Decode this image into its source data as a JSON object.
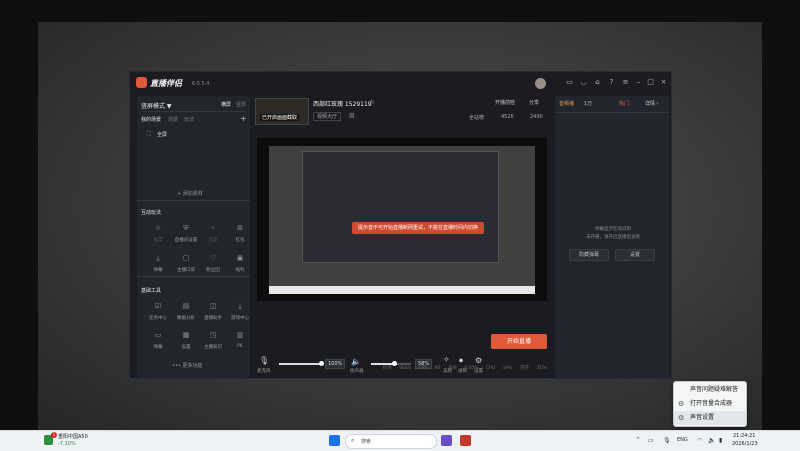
{
  "app": {
    "brand": "直播伴侣",
    "version": "6.5.5.4",
    "title_icons": [
      "chat-icon",
      "headset-icon",
      "shirt-icon",
      "help-icon",
      "menu-icon",
      "minimize-icon",
      "maximize-icon",
      "close-icon"
    ]
  },
  "left": {
    "mode_label": "竖屏模式 ▼",
    "orient_a": "横屏",
    "orient_b": "竖屏",
    "tabs": [
      "我的场景",
      "场景",
      "玩法"
    ],
    "add_icon": "+",
    "scene_item": "全屏",
    "add_material": "+ 添加素材",
    "interactive_title": "互动玩法",
    "interactive_items": [
      "投票",
      "直播间设置",
      "连麦",
      "红包",
      "弹幕",
      "主播口袋",
      "粉丝团",
      "福利"
    ],
    "tools_title": "基础工具",
    "tools_items": [
      "任务中心",
      "数据分析",
      "直播助手",
      "游戏中心",
      "弹幕",
      "设置",
      "主播知识",
      "PK"
    ],
    "more": "••• 更多功能"
  },
  "center": {
    "thumb_label": "已开启画面截取",
    "room_title": "西部红玫瑰 1529119",
    "tag": "视频大厅",
    "share": "分享",
    "live_tool": "开播前检",
    "stat_label": "全站榜",
    "likes": "4526",
    "viewers": "2490",
    "toast": "提示音不可开始直播断网重试，不能在直播时间内切换",
    "mic_label": "麦克风",
    "mic_pct": "100%",
    "spk_label": "扬声器",
    "spk_pct": "58%",
    "beauty_label": "美颜",
    "record_label": "录制",
    "settings_label": "设置",
    "start_button": "开始直播",
    "status": [
      "码率 0kb/s",
      "FPS 60",
      "丢帧 0.00%",
      "CPU 19%",
      "内存 31%",
      "全屏"
    ]
  },
  "right": {
    "live_label": "音频播",
    "fans": "1万",
    "hot": "热门",
    "detail": "详情 ›",
    "empty_line1": "弹幕显示区域说明",
    "empty_line2": "未开播，请开启直播后查看",
    "btn_a": "隐藏弹幕",
    "btn_b": "设置"
  },
  "context_menu": {
    "items": [
      "声音问题疑难解答",
      "打开音量合成器",
      "声音设置"
    ]
  },
  "taskbar": {
    "weather_temp": "1",
    "weather_name": "重阳中国A50",
    "weather_change": "-7.10%",
    "search": "搜索",
    "lang": "ENG",
    "time": "21:24:21",
    "date": "2026/1/23"
  },
  "colors": {
    "accent": "#e05a3a",
    "panel": "#23252e",
    "app_bg": "#1b1c22"
  }
}
